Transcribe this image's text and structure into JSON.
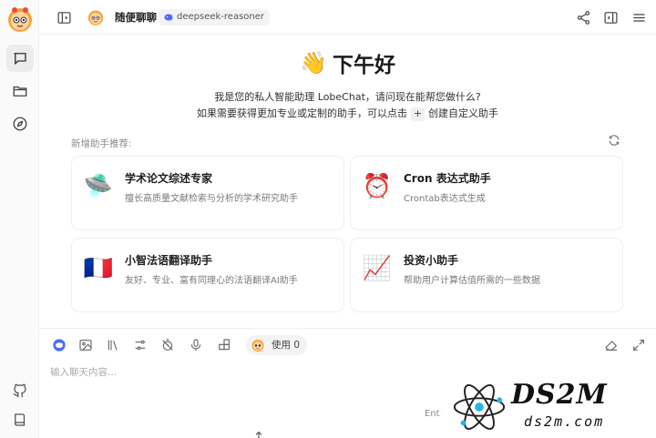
{
  "header": {
    "chat_title": "随便聊聊",
    "model_name": "deepseek-reasoner"
  },
  "welcome": {
    "greeting": "下午好",
    "greeting_emoji": "👋",
    "intro_line1": "我是您的私人智能助理 LobeChat，请问现在能帮您做什么?",
    "intro_line2_before": "如果需要获得更加专业或定制的助手，可以点击",
    "intro_plus": "+",
    "intro_line2_after": "创建自定义助手"
  },
  "recommend": {
    "label": "新增助手推荐:",
    "cards": [
      {
        "emoji": "🛸",
        "title": "学术论文综述专家",
        "desc": "擅长高质量文献检索与分析的学术研究助手"
      },
      {
        "emoji": "⏰",
        "title": "Cron 表达式助手",
        "desc": "Crontab表达式生成"
      },
      {
        "emoji": "🇫🇷",
        "title": "小智法语翻译助手",
        "desc": "友好、专业、富有同理心的法语翻译AI助手"
      },
      {
        "emoji": "📈",
        "title": "投资小助手",
        "desc": "帮助用户计算估值所需的一些数据"
      }
    ]
  },
  "input": {
    "use_label": "使用 0",
    "placeholder": "输入聊天内容...",
    "enter_hint": "Ente"
  },
  "watermark": {
    "main": "DS2M",
    "sub": "ds2m.com"
  },
  "icons": {
    "sidebar": [
      "chat-icon",
      "folder-icon",
      "compass-icon",
      "github-icon",
      "book-icon"
    ],
    "topbar": [
      "sidebar-toggle-icon",
      "share-icon",
      "panel-icon",
      "menu-icon"
    ],
    "toolbar": [
      "model-icon",
      "image-icon",
      "library-icon",
      "sliders-icon",
      "timer-off-icon",
      "mic-icon",
      "plugins-icon",
      "eraser-icon",
      "expand-icon"
    ]
  },
  "colors": {
    "accent": "#1f6feb",
    "sidebar_bg": "#fafafa",
    "text": "#1f1f1f",
    "muted": "#7a7a7a"
  }
}
